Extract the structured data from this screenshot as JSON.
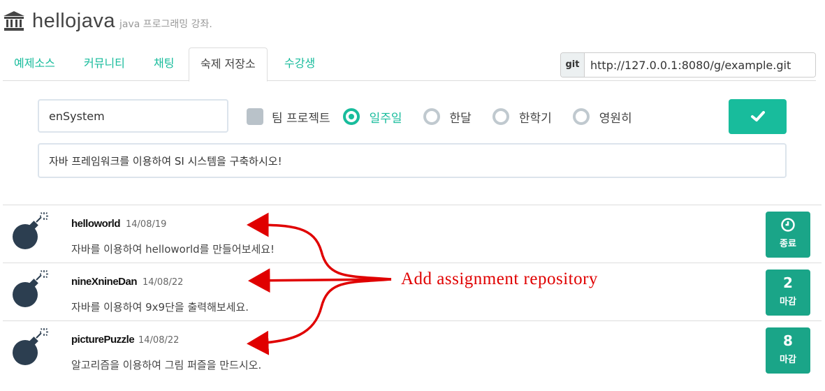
{
  "header": {
    "brand": "hellojava",
    "tagline": "java 프로그래밍 강좌.",
    "logo_icon": "bank-icon"
  },
  "tabs": [
    {
      "label": "예제소스",
      "active": false
    },
    {
      "label": "커뮤니티",
      "active": false
    },
    {
      "label": "채팅",
      "active": false
    },
    {
      "label": "숙제 저장소",
      "active": true
    },
    {
      "label": "수강생",
      "active": false
    }
  ],
  "git": {
    "addon": "git",
    "url": "http://127.0.0.1:8080/g/example.git"
  },
  "form": {
    "name_value": "enSystem",
    "team_project_label": "팀 프로젝트",
    "team_project_checked": false,
    "duration_options": [
      "일주일",
      "한달",
      "한학기",
      "영원히"
    ],
    "duration_selected": "일주일",
    "submit_icon": "checkmark-icon",
    "description_value": "자바 프레임워크를 이용하여 SI 시스템을 구축하시오!"
  },
  "assignments": [
    {
      "title": "helloworld",
      "date": "14/08/19",
      "description": "자바를 이용하여 helloworld를 만들어보세요!",
      "badge_icon": "clock-icon",
      "badge_value": "",
      "badge_label": "종료"
    },
    {
      "title": "nineXnineDan",
      "date": "14/08/22",
      "description": "자바를 이용하여 9x9단을 출력해보세요.",
      "badge_icon": "",
      "badge_value": "2",
      "badge_label": "마감"
    },
    {
      "title": "picturePuzzle",
      "date": "14/08/22",
      "description": "알고리즘을 이용하여 그림 퍼즐을 만드시오.",
      "badge_icon": "",
      "badge_value": "8",
      "badge_label": "마감"
    }
  ],
  "annotation": {
    "text": "Add assignment repository",
    "color": "#e00000"
  },
  "colors": {
    "accent": "#18bc9c",
    "badge": "#1aa588",
    "bomb": "#2c3e50"
  }
}
